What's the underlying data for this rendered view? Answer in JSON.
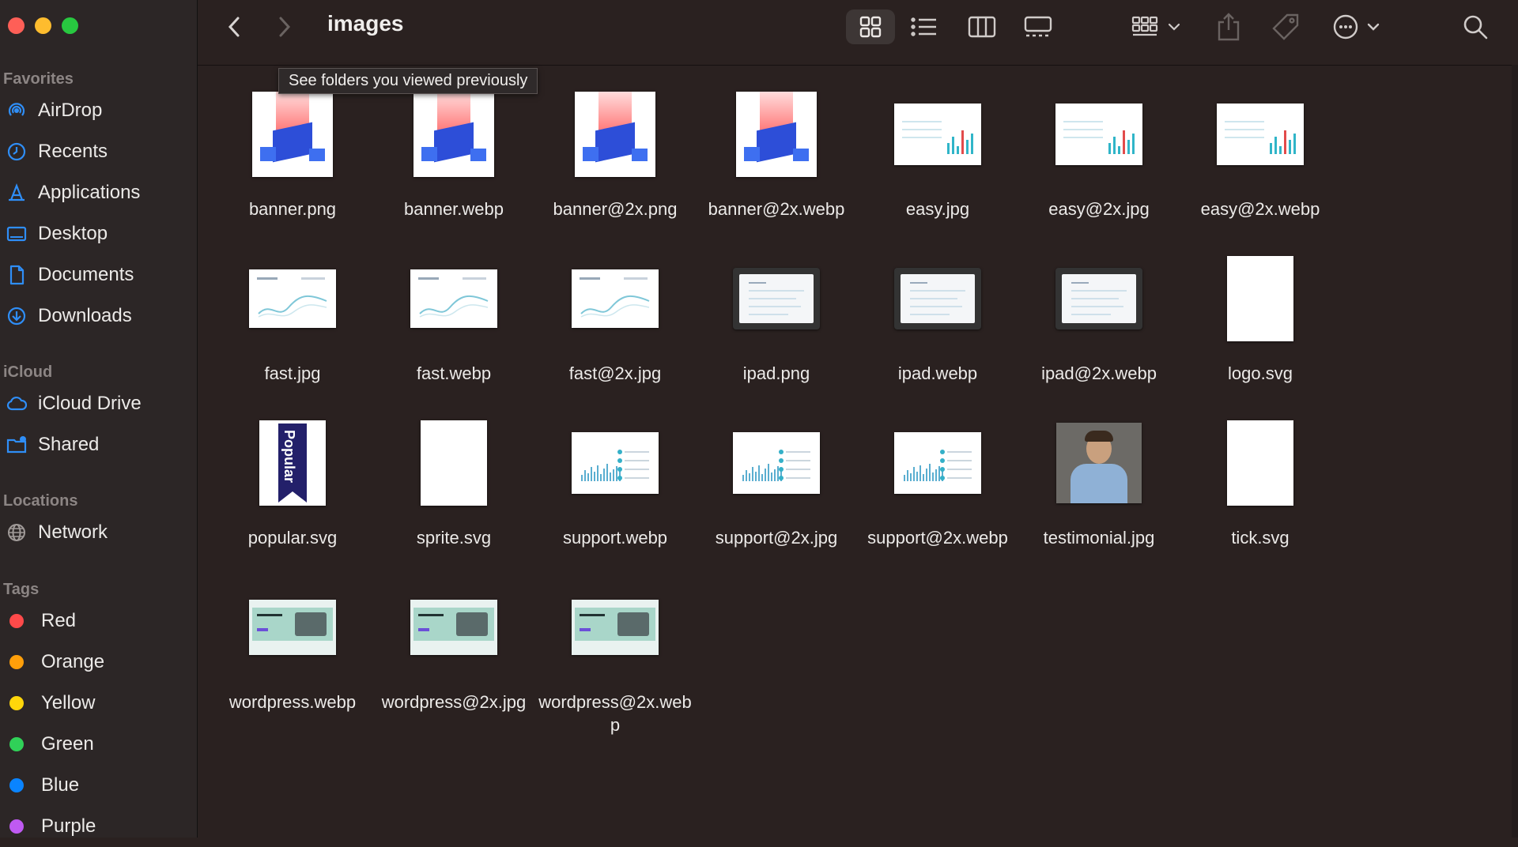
{
  "window": {
    "title": "images",
    "tooltip": "See folders you viewed previously"
  },
  "sidebar": {
    "favorites_heading": "Favorites",
    "favorites": [
      {
        "label": "AirDrop",
        "icon": "airdrop-icon"
      },
      {
        "label": "Recents",
        "icon": "clock-icon"
      },
      {
        "label": "Applications",
        "icon": "applications-icon"
      },
      {
        "label": "Desktop",
        "icon": "desktop-icon"
      },
      {
        "label": "Documents",
        "icon": "document-icon"
      },
      {
        "label": "Downloads",
        "icon": "download-icon"
      }
    ],
    "icloud_heading": "iCloud",
    "icloud": [
      {
        "label": "iCloud Drive",
        "icon": "cloud-icon"
      },
      {
        "label": "Shared",
        "icon": "shared-folder-icon"
      }
    ],
    "locations_heading": "Locations",
    "locations": [
      {
        "label": "Network",
        "icon": "globe-icon"
      }
    ],
    "tags_heading": "Tags",
    "tags": [
      {
        "label": "Red",
        "color": "#ff4a4a"
      },
      {
        "label": "Orange",
        "color": "#ff9f0a"
      },
      {
        "label": "Yellow",
        "color": "#ffd60a"
      },
      {
        "label": "Green",
        "color": "#30d158"
      },
      {
        "label": "Blue",
        "color": "#0a84ff"
      },
      {
        "label": "Purple",
        "color": "#bf5af2"
      }
    ]
  },
  "files": [
    {
      "name": "banner.png",
      "kind": "banner"
    },
    {
      "name": "banner.webp",
      "kind": "banner"
    },
    {
      "name": "banner@2x.png",
      "kind": "banner"
    },
    {
      "name": "banner@2x.webp",
      "kind": "banner"
    },
    {
      "name": "easy.jpg",
      "kind": "chart"
    },
    {
      "name": "easy@2x.jpg",
      "kind": "chart"
    },
    {
      "name": "easy@2x.webp",
      "kind": "chart"
    },
    {
      "name": "fast.jpg",
      "kind": "fast"
    },
    {
      "name": "fast.webp",
      "kind": "fast"
    },
    {
      "name": "fast@2x.jpg",
      "kind": "fast"
    },
    {
      "name": "ipad.png",
      "kind": "ipad"
    },
    {
      "name": "ipad.webp",
      "kind": "ipad"
    },
    {
      "name": "ipad@2x.webp",
      "kind": "ipad"
    },
    {
      "name": "logo.svg",
      "kind": "doc"
    },
    {
      "name": "popular.svg",
      "kind": "popular",
      "text": "Popular"
    },
    {
      "name": "sprite.svg",
      "kind": "doc"
    },
    {
      "name": "support.webp",
      "kind": "support"
    },
    {
      "name": "support@2x.jpg",
      "kind": "support"
    },
    {
      "name": "support@2x.webp",
      "kind": "support"
    },
    {
      "name": "testimonial.jpg",
      "kind": "photo"
    },
    {
      "name": "tick.svg",
      "kind": "doc"
    },
    {
      "name": "wordpress.webp",
      "kind": "wp"
    },
    {
      "name": "wordpress@2x.jpg",
      "kind": "wp"
    },
    {
      "name": "wordpress@2x.webp",
      "kind": "wp"
    }
  ],
  "colors": {
    "accent": "#2f8ef7",
    "window_bg": "#2a2120",
    "sidebar_bg": "#2c2626"
  }
}
